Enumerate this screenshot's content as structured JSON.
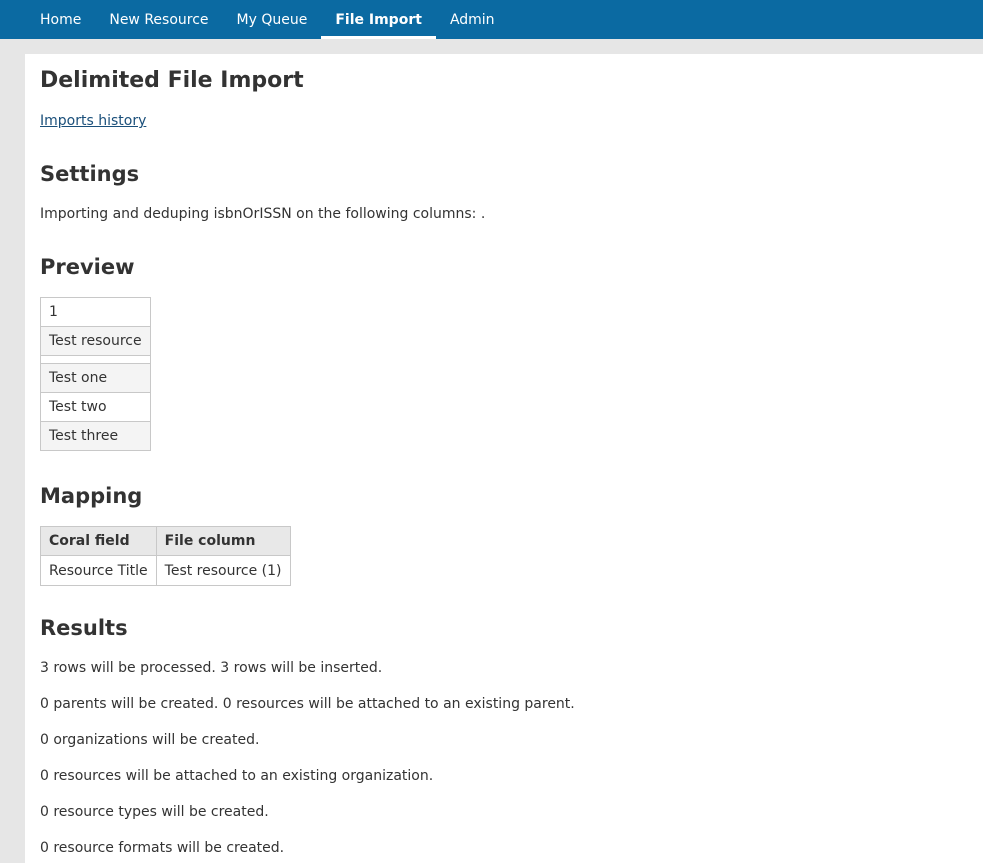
{
  "nav": {
    "items": [
      {
        "label": "Home"
      },
      {
        "label": "New Resource"
      },
      {
        "label": "My Queue"
      },
      {
        "label": "File Import",
        "active": true
      },
      {
        "label": "Admin"
      }
    ],
    "color": "#0b6aa2"
  },
  "page": {
    "title": "Delimited File Import",
    "history_link": "Imports history"
  },
  "settings": {
    "heading": "Settings",
    "text": "Importing and deduping isbnOrISSN on the following columns: ."
  },
  "preview": {
    "heading": "Preview",
    "rows": [
      "1",
      "Test resource",
      "",
      "Test one",
      "Test two",
      "Test three"
    ]
  },
  "mapping": {
    "heading": "Mapping",
    "headers": [
      "Coral field",
      "File column"
    ],
    "rows": [
      [
        "Resource Title",
        "Test resource (1)"
      ]
    ]
  },
  "results": {
    "heading": "Results",
    "lines": [
      "3 rows will be processed. 3 rows will be inserted.",
      "0 parents will be created. 0 resources will be attached to an existing parent.",
      "0 organizations will be created.",
      "0 resources will be attached to an existing organization.",
      "0 resource types will be created.",
      "0 resource formats will be created."
    ]
  }
}
